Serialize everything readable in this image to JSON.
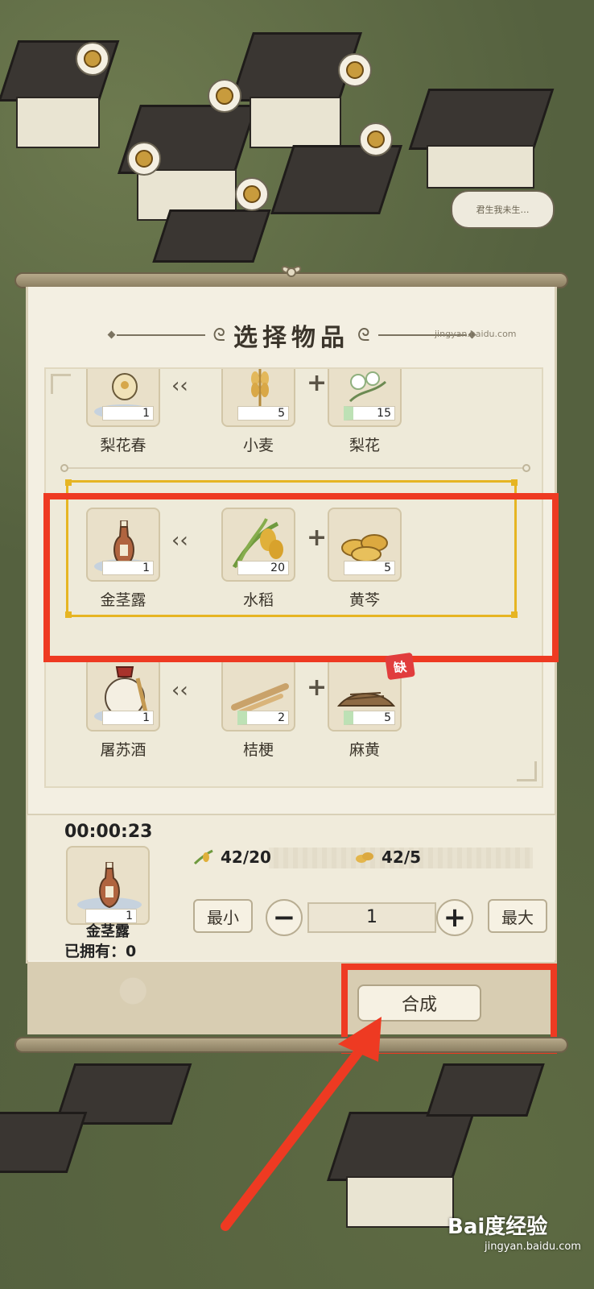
{
  "background": {
    "speech_text": "君生我未生…"
  },
  "dialog": {
    "title": "选择物品",
    "site_label": "jingyan.baidu.com"
  },
  "recipes": [
    {
      "product": {
        "name": "梨花春",
        "qty": "1",
        "icon": "wine-pot-icon"
      },
      "ingredients": [
        {
          "name": "小麦",
          "qty": "5",
          "icon": "wheat-icon"
        },
        {
          "name": "梨花",
          "qty": "15",
          "icon": "pear-blossom-icon"
        }
      ]
    },
    {
      "product": {
        "name": "金茎露",
        "qty": "1",
        "icon": "wine-bottle-icon"
      },
      "ingredients": [
        {
          "name": "水稻",
          "qty": "20",
          "icon": "rice-icon"
        },
        {
          "name": "黄芩",
          "qty": "5",
          "icon": "skullcap-root-icon"
        }
      ],
      "selected": true
    },
    {
      "product": {
        "name": "屠苏酒",
        "qty": "1",
        "icon": "wine-jar-icon"
      },
      "ingredients": [
        {
          "name": "桔梗",
          "qty": "2",
          "icon": "platycodon-root-icon"
        },
        {
          "name": "麻黄",
          "qty": "5",
          "icon": "ephedra-icon"
        }
      ],
      "missing_badge": "缺"
    }
  ],
  "synthesis": {
    "timer": "00:00:23",
    "product_name": "金茎露",
    "product_qty": "1",
    "owned_label": "已拥有：0",
    "requirements": [
      {
        "icon": "rice-icon",
        "text": "42/20"
      },
      {
        "icon": "skullcap-root-icon",
        "text": "42/5"
      }
    ],
    "min_label": "最小",
    "max_label": "最大",
    "quantity": "1",
    "craft_label": "合成"
  },
  "watermark": {
    "brand": "Bai度经验",
    "url": "jingyan.baidu.com"
  },
  "colors": {
    "highlight_red": "#ee3a22",
    "selected_gold": "#e6b523",
    "paper": "#f3efe2"
  }
}
